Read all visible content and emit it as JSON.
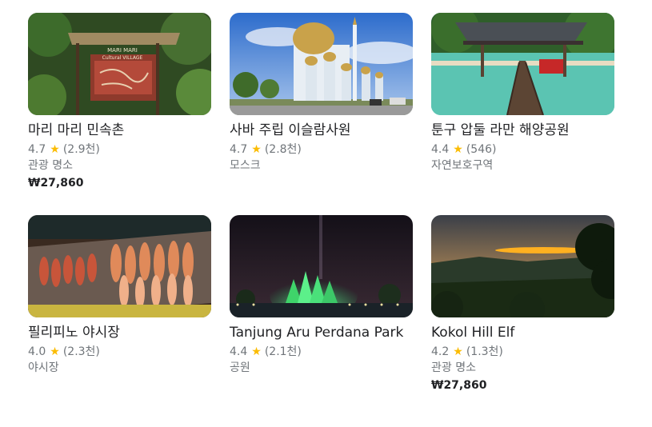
{
  "places": [
    {
      "name": "마리 마리 민속촌",
      "rating": "4.7",
      "reviews": "(2.9천)",
      "category": "관광 명소",
      "price": "₩27,860",
      "star_icon": "star-icon"
    },
    {
      "name": "사바 주립 이슬람사원",
      "rating": "4.7",
      "reviews": "(2.8천)",
      "category": "모스크",
      "price": "",
      "star_icon": "star-icon"
    },
    {
      "name": "툰구 압둘 라만 해양공원",
      "rating": "4.4",
      "reviews": "(546)",
      "category": "자연보호구역",
      "price": "",
      "star_icon": "star-icon"
    },
    {
      "name": "필리피노 야시장",
      "rating": "4.0",
      "reviews": "(2.3천)",
      "category": "야시장",
      "price": "",
      "star_icon": "star-icon"
    },
    {
      "name": "Tanjung Aru Perdana Park",
      "rating": "4.4",
      "reviews": "(2.1천)",
      "category": "공원",
      "price": "",
      "star_icon": "star-icon"
    },
    {
      "name": "Kokol Hill Elf",
      "rating": "4.2",
      "reviews": "(1.3천)",
      "category": "관광 명소",
      "price": "₩27,860",
      "star_icon": "star-icon"
    }
  ],
  "photo_texts": {
    "village_sign": "MARI MARI",
    "village_sign_sub": "Cultural VILLAGE"
  },
  "colors": {
    "star": "#fbbc04",
    "title_text": "#202124",
    "secondary_text": "#70757a"
  }
}
